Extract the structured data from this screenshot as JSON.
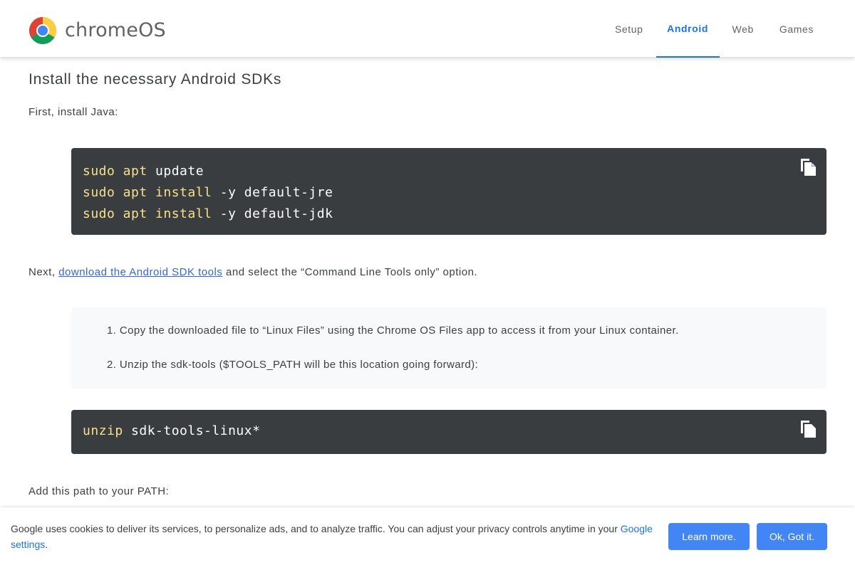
{
  "header": {
    "brand": "chromeOS",
    "nav": [
      {
        "label": "Setup"
      },
      {
        "label": "Android"
      },
      {
        "label": "Web"
      },
      {
        "label": "Games"
      }
    ],
    "active_tab": "Android",
    "accent_color": "#1a73e8",
    "logo_icon": "chrome-logo-icon"
  },
  "content": {
    "heading": "Install the necessary Android SDKs",
    "intro": "First, install Java:",
    "code_block_1": {
      "lines": [
        {
          "cmd": "sudo apt",
          "rest": " update"
        },
        {
          "cmd": "sudo apt install",
          "rest": " -y default-jre"
        },
        {
          "cmd": "sudo apt install",
          "rest": " -y default-jdk"
        }
      ],
      "copy_icon": "copy-icon"
    },
    "next_para": {
      "prefix": "Next, ",
      "link": "download the Android SDK tools",
      "suffix": " and select the “Command Line Tools only” option."
    },
    "steps": [
      "1. Copy the downloaded file to “Linux Files” using the Chrome OS Files app to access it from your Linux container.",
      "2. Unzip the sdk-tools ($TOOLS_PATH will be this location going forward):"
    ],
    "code_block_2": {
      "lines": [
        {
          "cmd": "unzip",
          "rest": " sdk-tools-linux*"
        }
      ],
      "copy_icon": "copy-icon"
    },
    "path_para": "Add this path to your PATH:"
  },
  "cookie_bar": {
    "text": "Google uses cookies to deliver its services, to personalize ads, and to analyze traffic. You can adjust your privacy controls anytime in your ",
    "link": "Google settings",
    "suffix": ".",
    "learn_more": "Learn more.",
    "ok": "Ok, Got it.",
    "button_color": "#4285f4"
  },
  "colors": {
    "code_bg": "#3a3d40",
    "code_keyword": "#f7e08a",
    "link": "#3367d6"
  }
}
